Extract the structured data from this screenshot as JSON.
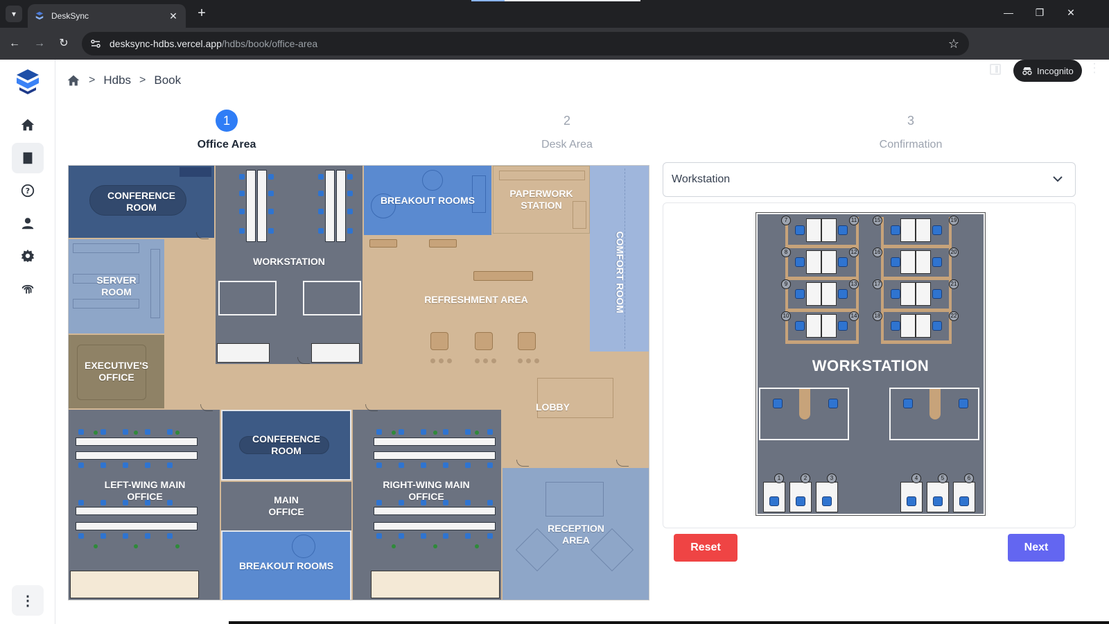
{
  "browser": {
    "tab_title": "DeskSync",
    "url_host": "desksync-hdbs.vercel.app",
    "url_path": "/hdbs/book/office-area",
    "incognito_label": "Incognito"
  },
  "breadcrumb": [
    "Hdbs",
    "Book"
  ],
  "stepper": [
    {
      "num": "1",
      "label": "Office Area"
    },
    {
      "num": "2",
      "label": "Desk Area"
    },
    {
      "num": "3",
      "label": "Confirmation"
    }
  ],
  "floor_plan": {
    "rooms": {
      "conference_top": "CONFERENCE ROOM",
      "server": "SERVER ROOM",
      "executive": "EXECUTIVE'S OFFICE",
      "workstation": "WORKSTATION",
      "breakout_top": "BREAKOUT ROOMS",
      "paperwork": "PAPERWORK STATION",
      "comfort": "COMFORT ROOM",
      "refreshment": "REFRESHMENT AREA",
      "lobby": "LOBBY",
      "left_wing": "LEFT-WING MAIN OFFICE",
      "conference_mid": "CONFERENCE ROOM",
      "main_office": "MAIN OFFICE",
      "right_wing": "RIGHT-WING MAIN OFFICE",
      "breakout_bottom": "BREAKOUT ROOMS",
      "reception": "RECEPTION AREA"
    }
  },
  "area_select": {
    "value": "Workstation"
  },
  "preview": {
    "title": "WORKSTATION",
    "desk_numbers": [
      "7",
      "8",
      "9",
      "10",
      "11",
      "12",
      "13",
      "14",
      "15",
      "16",
      "17",
      "18",
      "19",
      "20",
      "21",
      "22",
      "1",
      "2",
      "3",
      "4",
      "5",
      "6"
    ]
  },
  "actions": {
    "reset": "Reset",
    "next": "Next"
  },
  "colors": {
    "step_active": "#2f7df6",
    "reset": "#ef4444",
    "next": "#6366f1"
  }
}
